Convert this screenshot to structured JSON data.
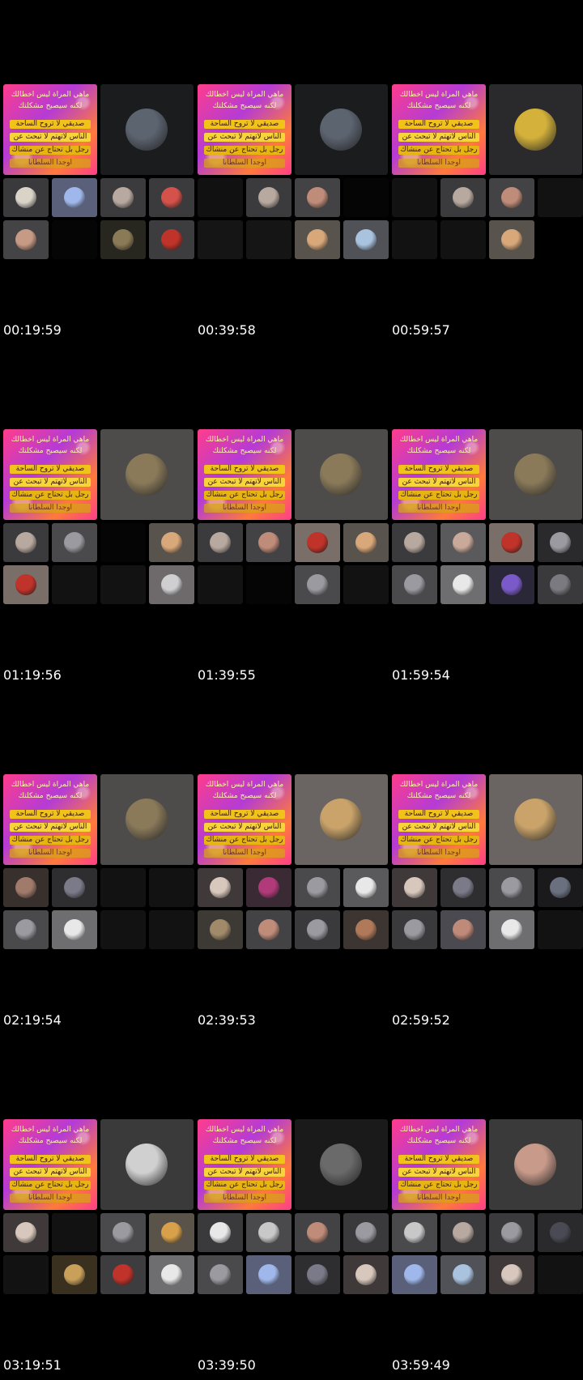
{
  "colors": {
    "background": "#000000",
    "timestamp_text": "#ffffff",
    "banner_gold": "#f0c21a",
    "banner_pink": "#ff3d8b"
  },
  "banner": {
    "line1": "ماهي المرأة ليس أخطالك",
    "line2": "لكنه سيصبح مشكلتك",
    "line3": "صديقي لا تروح الساحة",
    "line4": "الناس لاتهتم لا تبحث عن",
    "line5": "رجل بل تحتاج عن منشاك",
    "line6": "اوجدا السلطانا"
  },
  "frames": [
    {
      "timestamp": "00:19:59",
      "host": {
        "bg": "#1b1c1e",
        "avatar": "wolf-avatar",
        "avatar_color": "#5c6470"
      },
      "tiles": [
        {
          "bg": "#3a3a3d",
          "avatar": "profile-avatar",
          "color": "#d9d3c8"
        },
        {
          "bg": "#5a5f7a",
          "avatar": "profile-avatar",
          "color": "#9fb7ea"
        },
        {
          "bg": "#3b3b3e",
          "avatar": "profile-avatar",
          "color": "#b8a9a0"
        },
        {
          "bg": "#3b3b3e",
          "avatar": "profile-avatar",
          "color": "#d4524a"
        },
        {
          "bg": "#444447",
          "avatar": "profile-avatar",
          "color": "#c79a86"
        },
        {
          "bg": "#050505",
          "avatar": null,
          "color": null
        },
        {
          "bg": "#27261f",
          "avatar": "profile-avatar",
          "color": "#8a7a55"
        },
        {
          "bg": "#3d3d40",
          "avatar": "profile-avatar",
          "color": "#c0332a"
        }
      ]
    },
    {
      "timestamp": "00:39:58",
      "host": {
        "bg": "#1b1c1e",
        "avatar": "wolf-avatar",
        "avatar_color": "#5c6470"
      },
      "tiles": [
        {
          "bg": "#111111",
          "avatar": null,
          "color": null
        },
        {
          "bg": "#3b3b3e",
          "avatar": "profile-avatar",
          "color": "#b8a9a0"
        },
        {
          "bg": "#434346",
          "avatar": "profile-avatar",
          "color": "#c08c7a"
        },
        {
          "bg": "#050505",
          "avatar": null,
          "color": null
        },
        {
          "bg": "#151515",
          "avatar": null,
          "color": null
        },
        {
          "bg": "#151515",
          "avatar": null,
          "color": null
        },
        {
          "bg": "#58544d",
          "avatar": "profile-avatar",
          "color": "#d8a87a"
        },
        {
          "bg": "#505258",
          "avatar": "profile-avatar",
          "color": "#a9c2de"
        }
      ]
    },
    {
      "timestamp": "00:59:57",
      "host": {
        "bg": "#2a2a2c",
        "avatar": "flag-avatar",
        "avatar_color": "#d4b13a"
      },
      "tiles": [
        {
          "bg": "#121212",
          "avatar": null,
          "color": null
        },
        {
          "bg": "#3b3b3e",
          "avatar": "profile-avatar",
          "color": "#b8a9a0"
        },
        {
          "bg": "#434346",
          "avatar": "profile-avatar",
          "color": "#c08c7a"
        },
        {
          "bg": "#121212",
          "avatar": null,
          "color": null
        },
        {
          "bg": "#121212",
          "avatar": null,
          "color": null
        },
        {
          "bg": "#121212",
          "avatar": null,
          "color": null
        },
        {
          "bg": "#58544d",
          "avatar": "profile-avatar",
          "color": "#d8a87a"
        },
        {
          "bg": "#000000",
          "avatar": null,
          "color": null
        }
      ]
    },
    {
      "timestamp": "01:19:56",
      "host": {
        "bg": "#4d4c4a",
        "avatar": "car-avatar",
        "avatar_color": "#8a7a5a"
      },
      "tiles": [
        {
          "bg": "#3b3b3e",
          "avatar": "profile-avatar",
          "color": "#b8a9a0"
        },
        {
          "bg": "#4a4a4d",
          "avatar": "profile-avatar",
          "color": "#9a9aa0"
        },
        {
          "bg": "#050505",
          "avatar": null,
          "color": null
        },
        {
          "bg": "#58544d",
          "avatar": "profile-avatar",
          "color": "#d8a87a"
        },
        {
          "bg": "#7a6e69",
          "avatar": "flag-avatar",
          "color": "#c0332a"
        },
        {
          "bg": "#121212",
          "avatar": null,
          "color": null
        },
        {
          "bg": "#121212",
          "avatar": null,
          "color": null
        },
        {
          "bg": "#6e6a6c",
          "avatar": "profile-avatar",
          "color": "#cfcfd2"
        }
      ]
    },
    {
      "timestamp": "01:39:55",
      "host": {
        "bg": "#4d4c4a",
        "avatar": "car-avatar",
        "avatar_color": "#8a7a5a"
      },
      "tiles": [
        {
          "bg": "#3b3b3e",
          "avatar": "profile-avatar",
          "color": "#b8a9a0"
        },
        {
          "bg": "#434346",
          "avatar": "profile-avatar",
          "color": "#c08c7a"
        },
        {
          "bg": "#7a6e69",
          "avatar": "flag-avatar",
          "color": "#c0332a"
        },
        {
          "bg": "#58544d",
          "avatar": "profile-avatar",
          "color": "#d8a87a"
        },
        {
          "bg": "#121212",
          "avatar": null,
          "color": null
        },
        {
          "bg": "#050505",
          "avatar": null,
          "color": null
        },
        {
          "bg": "#4a4a4d",
          "avatar": "profile-avatar",
          "color": "#9a9aa0"
        },
        {
          "bg": "#121212",
          "avatar": null,
          "color": null
        }
      ]
    },
    {
      "timestamp": "01:59:54",
      "host": {
        "bg": "#4d4c4a",
        "avatar": "car-avatar",
        "avatar_color": "#8a7a5a"
      },
      "tiles": [
        {
          "bg": "#3b3b3e",
          "avatar": "profile-avatar",
          "color": "#b8a9a0"
        },
        {
          "bg": "#5a5a5d",
          "avatar": "profile-avatar",
          "color": "#c9a99a"
        },
        {
          "bg": "#7a6e69",
          "avatar": "flag-avatar",
          "color": "#c0332a"
        },
        {
          "bg": "#2a2a2c",
          "avatar": "profile-avatar",
          "color": "#9a9aa0"
        },
        {
          "bg": "#4a4a4d",
          "avatar": "profile-avatar",
          "color": "#9a9aa0"
        },
        {
          "bg": "#6e6e70",
          "avatar": "profile-avatar",
          "color": "#e8e8e8"
        },
        {
          "bg": "#2a2838",
          "avatar": "profile-avatar",
          "color": "#7a5ac8"
        },
        {
          "bg": "#3a3a3d",
          "avatar": "profile-avatar",
          "color": "#7a7a80"
        }
      ]
    },
    {
      "timestamp": "02:19:54",
      "host": {
        "bg": "#4d4c4a",
        "avatar": "car-avatar",
        "avatar_color": "#8a7a5a"
      },
      "tiles": [
        {
          "bg": "#38302d",
          "avatar": "profile-avatar",
          "color": "#a07a6a"
        },
        {
          "bg": "#2e2e31",
          "avatar": "profile-avatar",
          "color": "#7a7a88"
        },
        {
          "bg": "#121212",
          "avatar": null,
          "color": null
        },
        {
          "bg": "#121212",
          "avatar": null,
          "color": null
        },
        {
          "bg": "#4a4a4d",
          "avatar": "profile-avatar",
          "color": "#9a9aa0"
        },
        {
          "bg": "#6e6e70",
          "avatar": "profile-avatar",
          "color": "#e8e8e8"
        },
        {
          "bg": "#121212",
          "avatar": null,
          "color": null
        },
        {
          "bg": "#121212",
          "avatar": null,
          "color": null
        }
      ]
    },
    {
      "timestamp": "02:39:53",
      "host": {
        "bg": "#6a6562",
        "avatar": "man-avatar",
        "avatar_color": "#c9a36a"
      },
      "tiles": [
        {
          "bg": "#3f3a39",
          "avatar": "profile-avatar",
          "color": "#d8c7bc"
        },
        {
          "bg": "#3a2a33",
          "avatar": "profile-avatar",
          "color": "#b03a7a"
        },
        {
          "bg": "#4a4a4d",
          "avatar": "profile-avatar",
          "color": "#9a9aa0"
        },
        {
          "bg": "#5a5a5c",
          "avatar": "profile-avatar",
          "color": "#e8e8e8"
        },
        {
          "bg": "#3d3a36",
          "avatar": "profile-avatar",
          "color": "#a08a6a"
        },
        {
          "bg": "#434346",
          "avatar": "profile-avatar",
          "color": "#c08c7a"
        },
        {
          "bg": "#3a3a3d",
          "avatar": "profile-avatar",
          "color": "#9a9aa0"
        },
        {
          "bg": "#3d3532",
          "avatar": "profile-avatar",
          "color": "#b07a5a"
        }
      ]
    },
    {
      "timestamp": "02:59:52",
      "host": {
        "bg": "#6a6562",
        "avatar": "man-avatar",
        "avatar_color": "#c9a36a"
      },
      "tiles": [
        {
          "bg": "#3f3a39",
          "avatar": "profile-avatar",
          "color": "#d8c7bc"
        },
        {
          "bg": "#2e2e31",
          "avatar": "profile-avatar",
          "color": "#7a7a88"
        },
        {
          "bg": "#4a4a4d",
          "avatar": "profile-avatar",
          "color": "#9a9aa0"
        },
        {
          "bg": "#1a1a1c",
          "avatar": "profile-avatar",
          "color": "#6a7080"
        },
        {
          "bg": "#3a3a3d",
          "avatar": "profile-avatar",
          "color": "#9a9aa0"
        },
        {
          "bg": "#4a4a50",
          "avatar": "profile-avatar",
          "color": "#c08a7a"
        },
        {
          "bg": "#6e6e70",
          "avatar": "profile-avatar",
          "color": "#e8e8e8"
        },
        {
          "bg": "#121212",
          "avatar": null,
          "color": null
        }
      ]
    },
    {
      "timestamp": "03:19:51",
      "host": {
        "bg": "#3a3a3b",
        "avatar": "einstein-avatar",
        "avatar_color": "#d0d0d0"
      },
      "tiles": [
        {
          "bg": "#3f3a39",
          "avatar": "profile-avatar",
          "color": "#d8c7bc"
        },
        {
          "bg": "#121212",
          "avatar": null,
          "color": null
        },
        {
          "bg": "#4a4a4d",
          "avatar": "profile-avatar",
          "color": "#9a9aa0"
        },
        {
          "bg": "#5a534a",
          "avatar": "profile-avatar",
          "color": "#d8a04a"
        },
        {
          "bg": "#121212",
          "avatar": null,
          "color": null
        },
        {
          "bg": "#3a3020",
          "avatar": "profile-avatar",
          "color": "#c8a05a"
        },
        {
          "bg": "#3d3d40",
          "avatar": "profile-avatar",
          "color": "#c0332a"
        },
        {
          "bg": "#6e6e70",
          "avatar": "profile-avatar",
          "color": "#e8e8e8"
        }
      ]
    },
    {
      "timestamp": "03:39:50",
      "host": {
        "bg": "#1a1a1b",
        "avatar": "mask-avatar",
        "avatar_color": "#6a6a6a"
      },
      "tiles": [
        {
          "bg": "#3a3a3d",
          "avatar": "profile-avatar",
          "color": "#e8e8e8"
        },
        {
          "bg": "#4a4a4d",
          "avatar": "profile-avatar",
          "color": "#c8c8c8"
        },
        {
          "bg": "#434346",
          "avatar": "profile-avatar",
          "color": "#c08c7a"
        },
        {
          "bg": "#3a3a3d",
          "avatar": "profile-avatar",
          "color": "#9a9aa0"
        },
        {
          "bg": "#4a4a4d",
          "avatar": "profile-avatar",
          "color": "#9a9aa0"
        },
        {
          "bg": "#5a5f7a",
          "avatar": "profile-avatar",
          "color": "#9fb7ea"
        },
        {
          "bg": "#2e2e31",
          "avatar": "profile-avatar",
          "color": "#7a7a88"
        },
        {
          "bg": "#3f3a39",
          "avatar": "profile-avatar",
          "color": "#d8c7bc"
        }
      ]
    },
    {
      "timestamp": "03:59:49",
      "host": {
        "bg": "#3a3a3b",
        "avatar": "woman-avatar",
        "avatar_color": "#c89a8a"
      },
      "tiles": [
        {
          "bg": "#4a4a4d",
          "avatar": "profile-avatar",
          "color": "#c8c8c8"
        },
        {
          "bg": "#3b3b3e",
          "avatar": "profile-avatar",
          "color": "#b8a9a0"
        },
        {
          "bg": "#3a3a3d",
          "avatar": "profile-avatar",
          "color": "#9a9aa0"
        },
        {
          "bg": "#2a2a2c",
          "avatar": "profile-avatar",
          "color": "#4a4a55"
        },
        {
          "bg": "#5a5f7a",
          "avatar": "profile-avatar",
          "color": "#9fb7ea"
        },
        {
          "bg": "#505258",
          "avatar": "profile-avatar",
          "color": "#a9c2de"
        },
        {
          "bg": "#3f3a39",
          "avatar": "profile-avatar",
          "color": "#d8c7bc"
        },
        {
          "bg": "#121212",
          "avatar": null,
          "color": null
        }
      ]
    }
  ]
}
